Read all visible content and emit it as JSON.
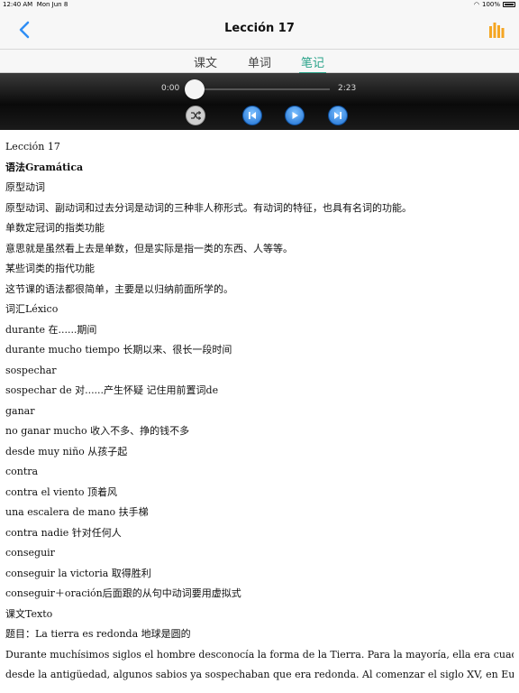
{
  "status": {
    "time": "12:40 AM",
    "date": "Mon Jun 8",
    "battery": "100%"
  },
  "nav": {
    "title": "Lección 17",
    "back_icon": "chevron-left-icon",
    "chart_icon": "bar-chart-icon",
    "accent": "#f5a623"
  },
  "tabs": [
    {
      "label": "课文",
      "active": false
    },
    {
      "label": "单词",
      "active": false
    },
    {
      "label": "笔记",
      "active": true
    }
  ],
  "player": {
    "elapsed": "0:00",
    "duration": "2:23",
    "progress": 0
  },
  "content": {
    "lines": [
      "Lección 17",
      "语法Gramática",
      "原型动词",
      "原型动词、副动词和过去分词是动词的三种非人称形式。有动词的特征，也具有名词的功能。",
      "单数定冠词的指类功能",
      "意思就是虽然看上去是单数，但是实际是指一类的东西、人等等。",
      "某些词类的指代功能",
      "这节课的语法都很简单，主要是以归纳前面所学的。",
      "词汇Léxico",
      "durante 在......期间",
      "durante mucho tiempo 长期以来、很长一段时间",
      "sospechar",
      "sospechar de 对......产生怀疑 记住用前置词de",
      "ganar",
      "no ganar mucho 收入不多、挣的钱不多",
      "desde muy niño 从孩子起",
      "contra",
      "contra el viento 顶着风",
      "una escalera de mano 扶手梯",
      "contra nadie 针对任何人",
      "conseguir",
      "conseguir la victoria 取得胜利",
      "conseguir＋oración后面跟的从句中动词要用虚拟式",
      "课文Texto",
      "题目：La tierra es redonda 地球是圆的",
      "Durante muchísimos siglos el hombre desconocía la forma de la Tierra. Para la mayoría, ella era cuadrada. Sin embargo,",
      "desde la antigüedad, algunos sabios ya sospechaban que era redonda. Al comenzar el siglo XV, en Europa, había cada día"
    ]
  }
}
